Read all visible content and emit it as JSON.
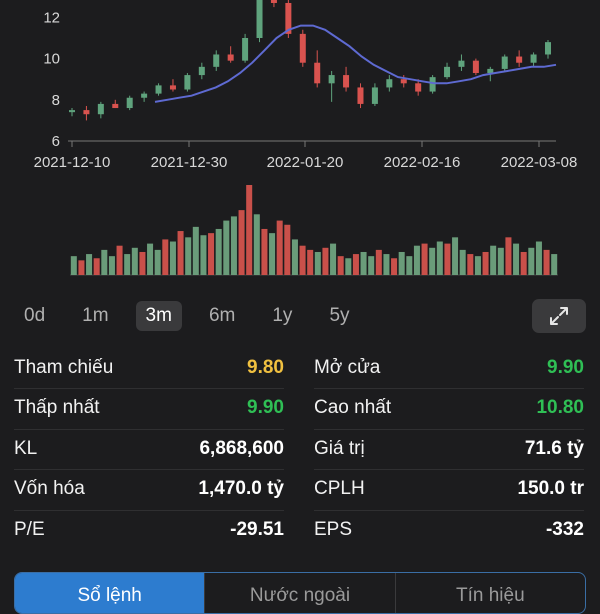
{
  "colors": {
    "up": "#5fa37d",
    "down": "#d9534f",
    "ma": "#5e6ad2",
    "reference": "#f0c040",
    "volume_up": "#6a9c7a",
    "volume_down": "#c9504a",
    "tab_active": "#2d7ccf"
  },
  "chart_data": [
    {
      "type": "candlestick",
      "title": "",
      "ylim": [
        6,
        14
      ],
      "y_ticks": [
        "12",
        "10",
        "8",
        "6"
      ],
      "x_ticks": [
        "2021-12-10",
        "2021-12-30",
        "2022-01-20",
        "2022-02-16",
        "2022-03-08"
      ],
      "moving_average": [
        7.9,
        8.0,
        8.1,
        8.2,
        8.4,
        8.6,
        8.9,
        9.3,
        9.8,
        10.4,
        11.0,
        11.4,
        11.6,
        11.6,
        11.4,
        11.0,
        10.6,
        10.1,
        9.7,
        9.4,
        9.1,
        9.0,
        8.9,
        8.8,
        8.8,
        8.9,
        9.0,
        9.2,
        9.3,
        9.4,
        9.5,
        9.6,
        9.6,
        9.7
      ],
      "candles": [
        {
          "o": 7.4,
          "h": 7.6,
          "l": 7.2,
          "c": 7.5
        },
        {
          "o": 7.5,
          "h": 7.7,
          "l": 7.0,
          "c": 7.3
        },
        {
          "o": 7.3,
          "h": 7.9,
          "l": 7.1,
          "c": 7.8
        },
        {
          "o": 7.8,
          "h": 8.0,
          "l": 7.6,
          "c": 7.6
        },
        {
          "o": 7.6,
          "h": 8.2,
          "l": 7.5,
          "c": 8.1
        },
        {
          "o": 8.1,
          "h": 8.4,
          "l": 7.9,
          "c": 8.3
        },
        {
          "o": 8.3,
          "h": 8.8,
          "l": 8.2,
          "c": 8.7
        },
        {
          "o": 8.7,
          "h": 9.0,
          "l": 8.4,
          "c": 8.5
        },
        {
          "o": 8.5,
          "h": 9.3,
          "l": 8.4,
          "c": 9.2
        },
        {
          "o": 9.2,
          "h": 9.8,
          "l": 9.0,
          "c": 9.6
        },
        {
          "o": 9.6,
          "h": 10.4,
          "l": 9.4,
          "c": 10.2
        },
        {
          "o": 10.2,
          "h": 10.6,
          "l": 9.8,
          "c": 9.9
        },
        {
          "o": 9.9,
          "h": 11.2,
          "l": 9.8,
          "c": 11.0
        },
        {
          "o": 11.0,
          "h": 13.6,
          "l": 10.8,
          "c": 13.4
        },
        {
          "o": 13.4,
          "h": 13.9,
          "l": 12.5,
          "c": 12.7
        },
        {
          "o": 12.7,
          "h": 13.0,
          "l": 11.0,
          "c": 11.2
        },
        {
          "o": 11.2,
          "h": 11.4,
          "l": 9.6,
          "c": 9.8
        },
        {
          "o": 9.8,
          "h": 10.4,
          "l": 8.6,
          "c": 8.8
        },
        {
          "o": 8.8,
          "h": 9.4,
          "l": 7.9,
          "c": 9.2
        },
        {
          "o": 9.2,
          "h": 9.6,
          "l": 8.4,
          "c": 8.6
        },
        {
          "o": 8.6,
          "h": 8.8,
          "l": 7.6,
          "c": 7.8
        },
        {
          "o": 7.8,
          "h": 8.8,
          "l": 7.7,
          "c": 8.6
        },
        {
          "o": 8.6,
          "h": 9.2,
          "l": 8.4,
          "c": 9.0
        },
        {
          "o": 9.0,
          "h": 9.2,
          "l": 8.6,
          "c": 8.8
        },
        {
          "o": 8.8,
          "h": 9.0,
          "l": 8.2,
          "c": 8.4
        },
        {
          "o": 8.4,
          "h": 9.2,
          "l": 8.3,
          "c": 9.1
        },
        {
          "o": 9.1,
          "h": 9.8,
          "l": 9.0,
          "c": 9.6
        },
        {
          "o": 9.6,
          "h": 10.2,
          "l": 9.4,
          "c": 9.9
        },
        {
          "o": 9.9,
          "h": 10.0,
          "l": 9.2,
          "c": 9.3
        },
        {
          "o": 9.3,
          "h": 9.6,
          "l": 8.9,
          "c": 9.5
        },
        {
          "o": 9.5,
          "h": 10.2,
          "l": 9.4,
          "c": 10.1
        },
        {
          "o": 10.1,
          "h": 10.4,
          "l": 9.6,
          "c": 9.8
        },
        {
          "o": 9.8,
          "h": 10.3,
          "l": 9.6,
          "c": 10.2
        },
        {
          "o": 10.2,
          "h": 10.9,
          "l": 10.0,
          "c": 10.8
        }
      ]
    },
    {
      "type": "bar",
      "title": "",
      "values": [
        18,
        14,
        20,
        16,
        24,
        18,
        28,
        20,
        26,
        22,
        30,
        24,
        34,
        32,
        42,
        36,
        46,
        38,
        40,
        44,
        52,
        56,
        62,
        86,
        58,
        44,
        40,
        52,
        48,
        34,
        28,
        24,
        22,
        26,
        30,
        18,
        16,
        20,
        22,
        18,
        24,
        20,
        16,
        22,
        18,
        28,
        30,
        26,
        32,
        30,
        36,
        24,
        20,
        18,
        22,
        28,
        26,
        36,
        30,
        22,
        26,
        32,
        24,
        20
      ],
      "directions": [
        "u",
        "d",
        "u",
        "d",
        "u",
        "u",
        "d",
        "u",
        "u",
        "d",
        "u",
        "u",
        "d",
        "u",
        "d",
        "u",
        "u",
        "u",
        "d",
        "u",
        "u",
        "u",
        "d",
        "d",
        "u",
        "d",
        "u",
        "d",
        "d",
        "u",
        "d",
        "d",
        "u",
        "d",
        "u",
        "d",
        "u",
        "d",
        "u",
        "u",
        "d",
        "u",
        "d",
        "u",
        "u",
        "u",
        "d",
        "u",
        "u",
        "d",
        "u",
        "u",
        "d",
        "u",
        "d",
        "u",
        "u",
        "d",
        "u",
        "d",
        "u",
        "u",
        "d",
        "u"
      ]
    }
  ],
  "ranges": {
    "items": [
      "0d",
      "1m",
      "3m",
      "6m",
      "1y",
      "5y"
    ],
    "active": "3m"
  },
  "stats": [
    {
      "left_label": "Tham chiếu",
      "left_value": "9.80",
      "left_color": "#f0c040",
      "right_label": "Mở cửa",
      "right_value": "9.90",
      "right_color": "#2fbf55"
    },
    {
      "left_label": "Thấp nhất",
      "left_value": "9.90",
      "left_color": "#2fbf55",
      "right_label": "Cao nhất",
      "right_value": "10.80",
      "right_color": "#2fbf55"
    },
    {
      "left_label": "KL",
      "left_value": "6,868,600",
      "left_color": "#ffffff",
      "right_label": "Giá trị",
      "right_value": "71.6 tỷ",
      "right_color": "#ffffff"
    },
    {
      "left_label": "Vốn hóa",
      "left_value": "1,470.0 tỷ",
      "left_color": "#ffffff",
      "right_label": "CPLH",
      "right_value": "150.0 tr",
      "right_color": "#ffffff"
    },
    {
      "left_label": "P/E",
      "left_value": "-29.51",
      "left_color": "#ffffff",
      "right_label": "EPS",
      "right_value": "-332",
      "right_color": "#ffffff"
    }
  ],
  "tabs": {
    "items": [
      "Sổ lệnh",
      "Nước ngoài",
      "Tín hiệu"
    ],
    "active": "Sổ lệnh"
  }
}
